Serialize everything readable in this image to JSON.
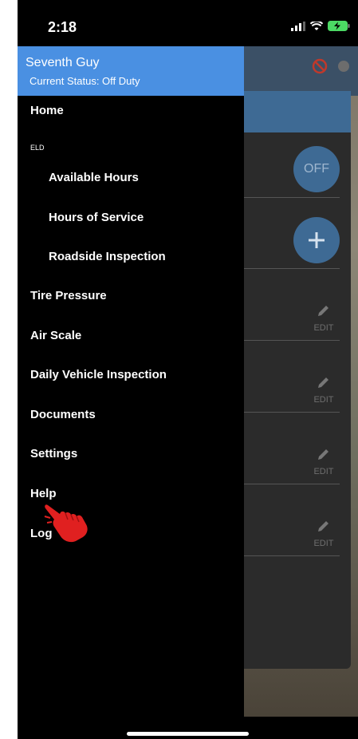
{
  "status_bar": {
    "time": "2:18"
  },
  "drawer": {
    "user_name": "Seventh Guy",
    "user_status": "Current Status: Off Duty",
    "items": [
      {
        "label": "Home"
      },
      {
        "label": "Available Hours"
      },
      {
        "label": "Hours of Service"
      },
      {
        "label": "Roadside Inspection"
      },
      {
        "label": "Tire Pressure"
      },
      {
        "label": "Air Scale"
      },
      {
        "label": "Daily Vehicle Inspection"
      },
      {
        "label": "Documents"
      },
      {
        "label": "Settings"
      },
      {
        "label": "Help"
      },
      {
        "label": "Log"
      }
    ],
    "section_eld": "ELD"
  },
  "background": {
    "status_button": "OFF",
    "edit_label": "EDIT"
  },
  "colors": {
    "drawer_header": "#4a90e2",
    "drawer_bg": "#000000",
    "accent_button": "#3e6a94"
  }
}
